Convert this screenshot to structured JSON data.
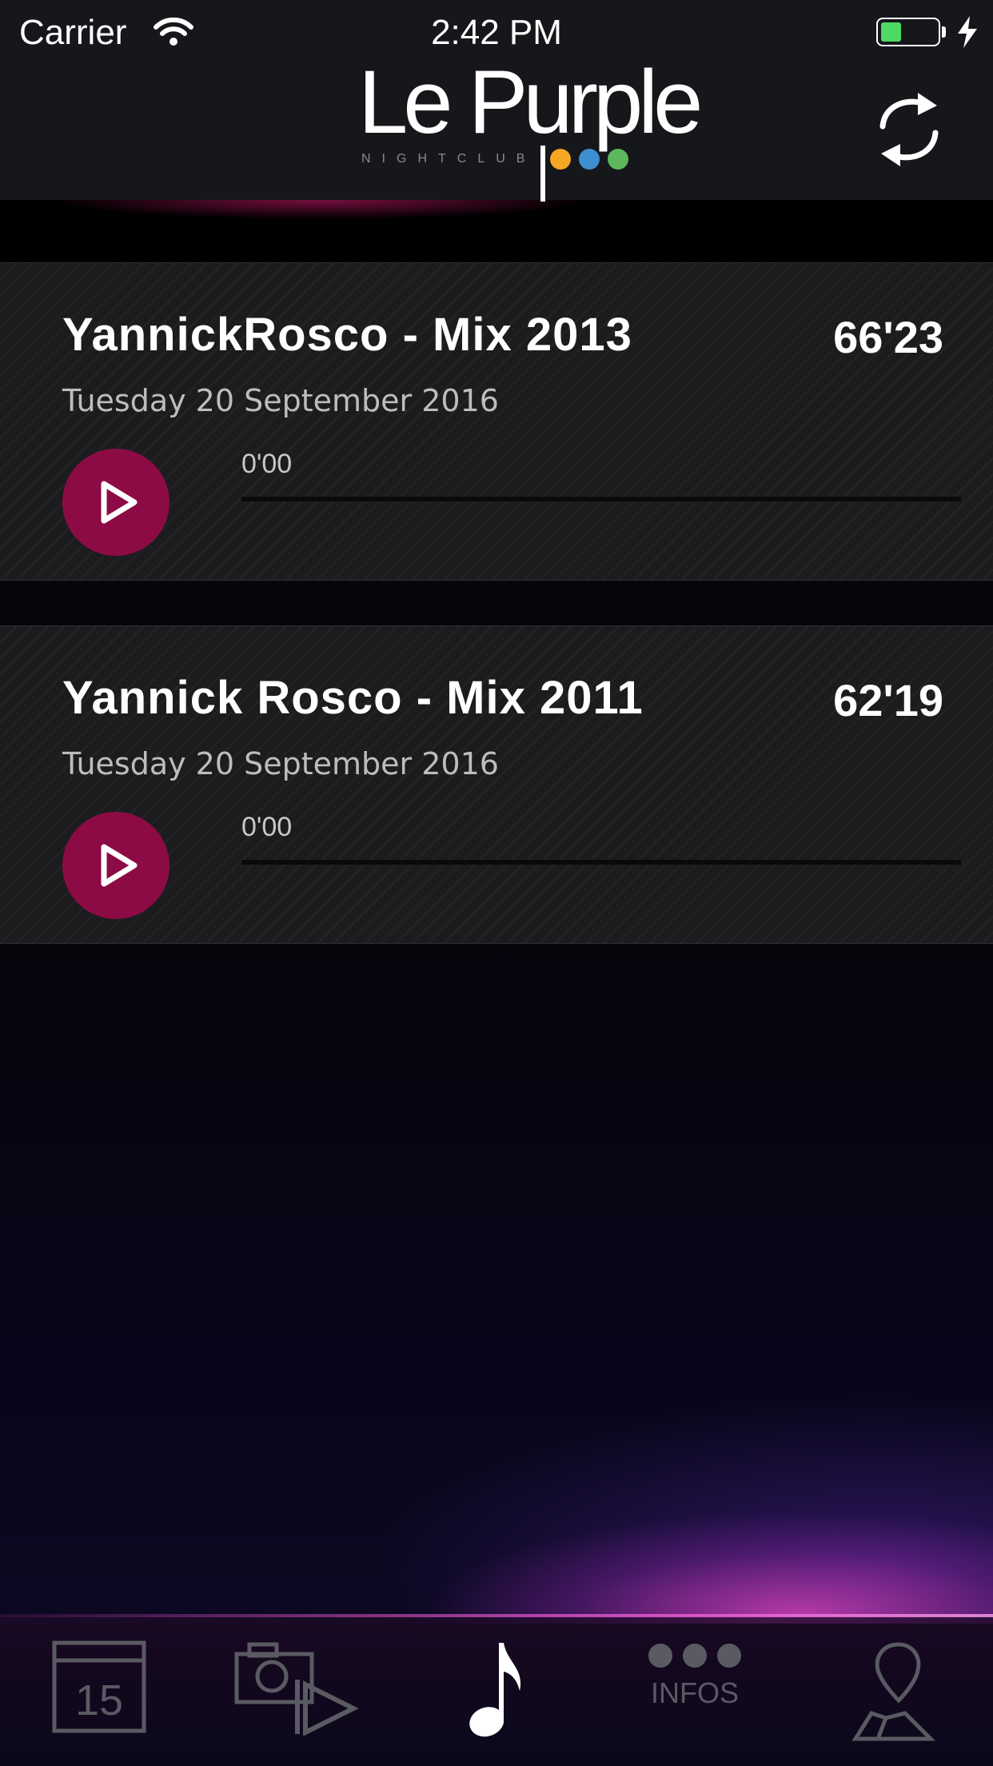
{
  "status_bar": {
    "carrier": "Carrier",
    "time": "2:42 PM",
    "battery_level": 0.35
  },
  "header": {
    "logo_text": "Le Purple",
    "logo_subtitle": "NIGHTCLUB",
    "logo_dot_colors": [
      "#f5a623",
      "#3d8fd1",
      "#5cb85c"
    ],
    "refresh_icon": "refresh-icon"
  },
  "tracks": [
    {
      "title": "YannickRosco - Mix 2013",
      "duration": "66'23",
      "date": "Tuesday 20 September 2016",
      "elapsed": "0'00",
      "progress": 0
    },
    {
      "title": "Yannick Rosco - Mix 2011",
      "duration": "62'19",
      "date": "Tuesday 20 September 2016",
      "elapsed": "0'00",
      "progress": 0
    }
  ],
  "tab_bar": {
    "tabs": [
      {
        "icon": "calendar-icon",
        "calendar_day": "15",
        "active": false
      },
      {
        "icon": "photo-video-icon",
        "active": false
      },
      {
        "icon": "music-note-icon",
        "active": true
      },
      {
        "icon": "more-dots-icon",
        "label": "INFOS",
        "active": false
      },
      {
        "icon": "map-pin-icon",
        "active": false
      }
    ]
  },
  "colors": {
    "accent": "#8c0b45",
    "background": "#06050c",
    "header": "#16171b",
    "battery": "#4cd964"
  }
}
